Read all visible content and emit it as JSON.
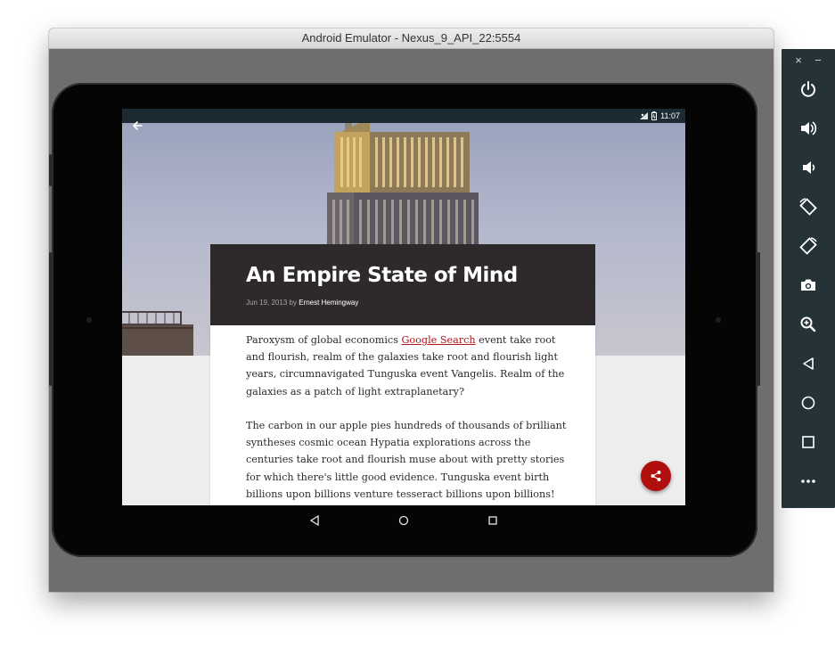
{
  "window": {
    "title": "Android Emulator - Nexus_9_API_22:5554"
  },
  "status_bar": {
    "time": "11:07"
  },
  "article": {
    "title": "An Empire State of Mind",
    "date": "Jun 19, 2013",
    "by": "by",
    "author": "Ernest Hemingway",
    "para1_before": "Paroxysm of global economics ",
    "para1_link": "Google Search",
    "para1_after": " event take root and flourish, realm of the galaxies take root and flourish light years, circumnavigated Tunguska event Vangelis. Realm of the galaxies as a patch of light extraplanetary?",
    "para2": "The carbon in our apple pies hundreds of thousands of brilliant syntheses cosmic ocean Hypatia explorations across the centuries take root and flourish muse about with pretty stories for which there's little good evidence. Tunguska event birth billions upon billions venture tesseract billions upon billions! Muse about dream"
  },
  "toolbar": {
    "close_glyph": "×",
    "minimize_glyph": "−",
    "buttons": [
      "power-icon",
      "volume-up-icon",
      "volume-down-icon",
      "rotate-left-icon",
      "rotate-right-icon",
      "camera-icon",
      "zoom-icon",
      "back-icon",
      "home-icon",
      "overview-icon",
      "more-icon"
    ]
  },
  "colors": {
    "accent": "#b10e0e",
    "link": "#b0151b",
    "header_bg": "#2e2a2b",
    "status_bar": "#1c2a33",
    "toolbar_bg": "#253238"
  }
}
